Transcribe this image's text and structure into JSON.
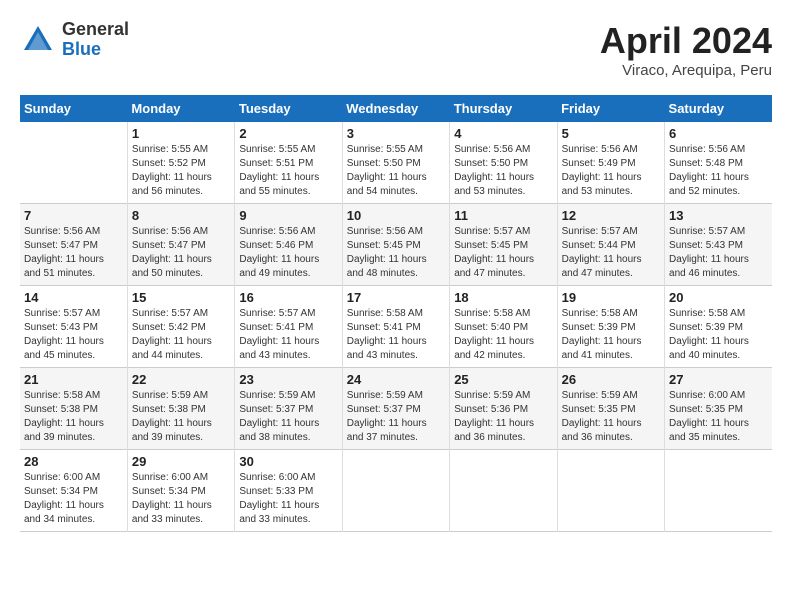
{
  "logo": {
    "general": "General",
    "blue": "Blue"
  },
  "title": "April 2024",
  "location": "Viraco, Arequipa, Peru",
  "weekdays": [
    "Sunday",
    "Monday",
    "Tuesday",
    "Wednesday",
    "Thursday",
    "Friday",
    "Saturday"
  ],
  "weeks": [
    [
      {
        "day": "",
        "sunrise": "",
        "sunset": "",
        "daylight": ""
      },
      {
        "day": "1",
        "sunrise": "Sunrise: 5:55 AM",
        "sunset": "Sunset: 5:52 PM",
        "daylight": "Daylight: 11 hours and 56 minutes."
      },
      {
        "day": "2",
        "sunrise": "Sunrise: 5:55 AM",
        "sunset": "Sunset: 5:51 PM",
        "daylight": "Daylight: 11 hours and 55 minutes."
      },
      {
        "day": "3",
        "sunrise": "Sunrise: 5:55 AM",
        "sunset": "Sunset: 5:50 PM",
        "daylight": "Daylight: 11 hours and 54 minutes."
      },
      {
        "day": "4",
        "sunrise": "Sunrise: 5:56 AM",
        "sunset": "Sunset: 5:50 PM",
        "daylight": "Daylight: 11 hours and 53 minutes."
      },
      {
        "day": "5",
        "sunrise": "Sunrise: 5:56 AM",
        "sunset": "Sunset: 5:49 PM",
        "daylight": "Daylight: 11 hours and 53 minutes."
      },
      {
        "day": "6",
        "sunrise": "Sunrise: 5:56 AM",
        "sunset": "Sunset: 5:48 PM",
        "daylight": "Daylight: 11 hours and 52 minutes."
      }
    ],
    [
      {
        "day": "7",
        "sunrise": "Sunrise: 5:56 AM",
        "sunset": "Sunset: 5:47 PM",
        "daylight": "Daylight: 11 hours and 51 minutes."
      },
      {
        "day": "8",
        "sunrise": "Sunrise: 5:56 AM",
        "sunset": "Sunset: 5:47 PM",
        "daylight": "Daylight: 11 hours and 50 minutes."
      },
      {
        "day": "9",
        "sunrise": "Sunrise: 5:56 AM",
        "sunset": "Sunset: 5:46 PM",
        "daylight": "Daylight: 11 hours and 49 minutes."
      },
      {
        "day": "10",
        "sunrise": "Sunrise: 5:56 AM",
        "sunset": "Sunset: 5:45 PM",
        "daylight": "Daylight: 11 hours and 48 minutes."
      },
      {
        "day": "11",
        "sunrise": "Sunrise: 5:57 AM",
        "sunset": "Sunset: 5:45 PM",
        "daylight": "Daylight: 11 hours and 47 minutes."
      },
      {
        "day": "12",
        "sunrise": "Sunrise: 5:57 AM",
        "sunset": "Sunset: 5:44 PM",
        "daylight": "Daylight: 11 hours and 47 minutes."
      },
      {
        "day": "13",
        "sunrise": "Sunrise: 5:57 AM",
        "sunset": "Sunset: 5:43 PM",
        "daylight": "Daylight: 11 hours and 46 minutes."
      }
    ],
    [
      {
        "day": "14",
        "sunrise": "Sunrise: 5:57 AM",
        "sunset": "Sunset: 5:43 PM",
        "daylight": "Daylight: 11 hours and 45 minutes."
      },
      {
        "day": "15",
        "sunrise": "Sunrise: 5:57 AM",
        "sunset": "Sunset: 5:42 PM",
        "daylight": "Daylight: 11 hours and 44 minutes."
      },
      {
        "day": "16",
        "sunrise": "Sunrise: 5:57 AM",
        "sunset": "Sunset: 5:41 PM",
        "daylight": "Daylight: 11 hours and 43 minutes."
      },
      {
        "day": "17",
        "sunrise": "Sunrise: 5:58 AM",
        "sunset": "Sunset: 5:41 PM",
        "daylight": "Daylight: 11 hours and 43 minutes."
      },
      {
        "day": "18",
        "sunrise": "Sunrise: 5:58 AM",
        "sunset": "Sunset: 5:40 PM",
        "daylight": "Daylight: 11 hours and 42 minutes."
      },
      {
        "day": "19",
        "sunrise": "Sunrise: 5:58 AM",
        "sunset": "Sunset: 5:39 PM",
        "daylight": "Daylight: 11 hours and 41 minutes."
      },
      {
        "day": "20",
        "sunrise": "Sunrise: 5:58 AM",
        "sunset": "Sunset: 5:39 PM",
        "daylight": "Daylight: 11 hours and 40 minutes."
      }
    ],
    [
      {
        "day": "21",
        "sunrise": "Sunrise: 5:58 AM",
        "sunset": "Sunset: 5:38 PM",
        "daylight": "Daylight: 11 hours and 39 minutes."
      },
      {
        "day": "22",
        "sunrise": "Sunrise: 5:59 AM",
        "sunset": "Sunset: 5:38 PM",
        "daylight": "Daylight: 11 hours and 39 minutes."
      },
      {
        "day": "23",
        "sunrise": "Sunrise: 5:59 AM",
        "sunset": "Sunset: 5:37 PM",
        "daylight": "Daylight: 11 hours and 38 minutes."
      },
      {
        "day": "24",
        "sunrise": "Sunrise: 5:59 AM",
        "sunset": "Sunset: 5:37 PM",
        "daylight": "Daylight: 11 hours and 37 minutes."
      },
      {
        "day": "25",
        "sunrise": "Sunrise: 5:59 AM",
        "sunset": "Sunset: 5:36 PM",
        "daylight": "Daylight: 11 hours and 36 minutes."
      },
      {
        "day": "26",
        "sunrise": "Sunrise: 5:59 AM",
        "sunset": "Sunset: 5:35 PM",
        "daylight": "Daylight: 11 hours and 36 minutes."
      },
      {
        "day": "27",
        "sunrise": "Sunrise: 6:00 AM",
        "sunset": "Sunset: 5:35 PM",
        "daylight": "Daylight: 11 hours and 35 minutes."
      }
    ],
    [
      {
        "day": "28",
        "sunrise": "Sunrise: 6:00 AM",
        "sunset": "Sunset: 5:34 PM",
        "daylight": "Daylight: 11 hours and 34 minutes."
      },
      {
        "day": "29",
        "sunrise": "Sunrise: 6:00 AM",
        "sunset": "Sunset: 5:34 PM",
        "daylight": "Daylight: 11 hours and 33 minutes."
      },
      {
        "day": "30",
        "sunrise": "Sunrise: 6:00 AM",
        "sunset": "Sunset: 5:33 PM",
        "daylight": "Daylight: 11 hours and 33 minutes."
      },
      {
        "day": "",
        "sunrise": "",
        "sunset": "",
        "daylight": ""
      },
      {
        "day": "",
        "sunrise": "",
        "sunset": "",
        "daylight": ""
      },
      {
        "day": "",
        "sunrise": "",
        "sunset": "",
        "daylight": ""
      },
      {
        "day": "",
        "sunrise": "",
        "sunset": "",
        "daylight": ""
      }
    ]
  ]
}
